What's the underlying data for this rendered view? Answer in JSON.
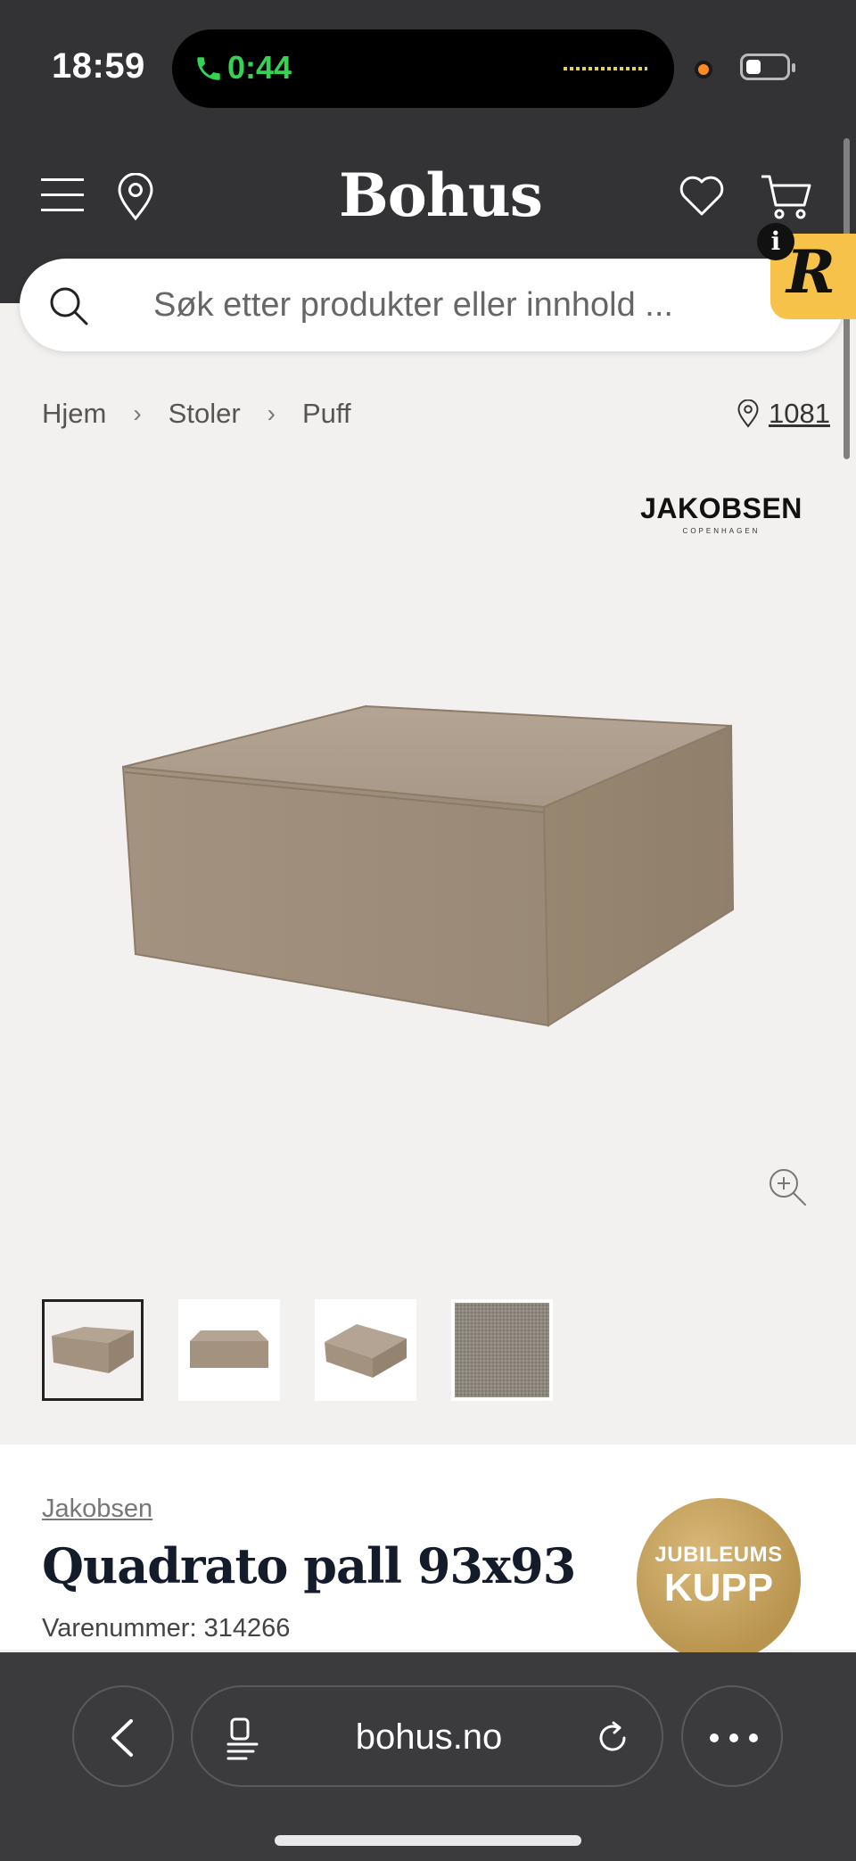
{
  "status_bar": {
    "time": "18:59",
    "call_time": "0:44"
  },
  "header": {
    "logo": "Bohus",
    "info_badge": "i",
    "assistant_badge": "R"
  },
  "search": {
    "placeholder": "Søk etter produkter eller innhold ..."
  },
  "breadcrumb": {
    "items": [
      "Hjem",
      "Stoler",
      "Puff"
    ],
    "separator": "›"
  },
  "store": {
    "label": "1081"
  },
  "brand_logo": {
    "name": "JAKOBSEN",
    "sub": "COPENHAGEN"
  },
  "product": {
    "brand": "Jakobsen",
    "title": "Quadrato pall 93x93",
    "sku": "Varenummer: 314266",
    "badge_line1": "JUBILEUMS",
    "badge_line2": "KUPP"
  },
  "browser": {
    "url": "bohus.no"
  },
  "colors": {
    "header": "#333336",
    "page": "#f3f1ef",
    "fabric": "#a89888",
    "badge_gold": "#c4a160",
    "call_green": "#35d352"
  }
}
